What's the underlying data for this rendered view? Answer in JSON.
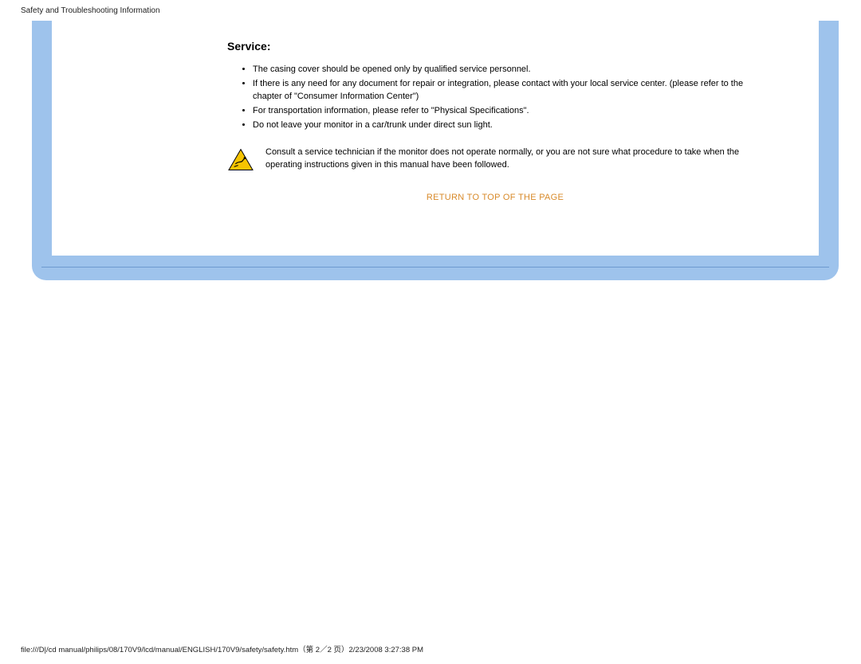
{
  "header": {
    "title": "Safety and Troubleshooting Information"
  },
  "service": {
    "heading": "Service",
    "items": [
      "The casing cover should be opened only by qualified service personnel.",
      "If there is any need for any document for repair or integration, please contact with your local service center. (please refer to the chapter of \"Consumer Information Center\")",
      "For transportation information, please refer to \"Physical Specifications\".",
      "Do not leave your monitor in a car/trunk under direct sun light."
    ],
    "note": "Consult a service technician if the monitor does not operate normally, or you are not sure what procedure to take when the operating instructions given in this manual have been followed."
  },
  "return_link": "RETURN TO TOP OF THE PAGE",
  "footer": {
    "text": "file:///D|/cd manual/philips/08/170V9/lcd/manual/ENGLISH/170V9/safety/safety.htm（第 2／2 页）2/23/2008 3:27:38 PM"
  }
}
